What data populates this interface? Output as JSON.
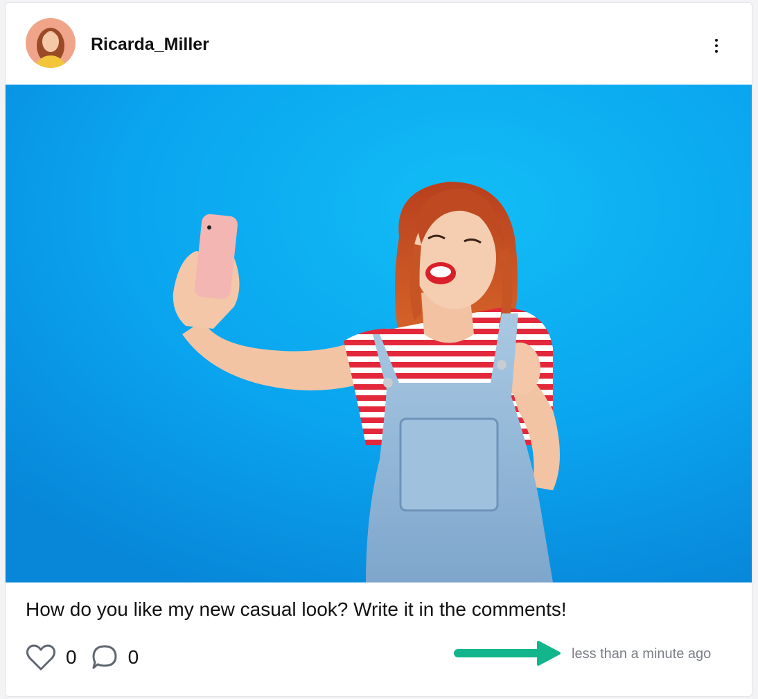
{
  "post": {
    "username": "Ricarda_Miller",
    "caption": "How do you like my new casual look? Write it in the comments!",
    "likes": "0",
    "comments": "0",
    "timestamp": "less than a minute ago"
  },
  "icons": {
    "avatar": "avatar",
    "menu": "more-vertical-icon",
    "like": "heart-icon",
    "comment": "comment-bubble-icon",
    "annotation": "arrow-right-icon"
  },
  "colors": {
    "photo_background": "#0aa4ef",
    "annotation_arrow": "#12b58c",
    "timestamp": "#7b7f86"
  }
}
